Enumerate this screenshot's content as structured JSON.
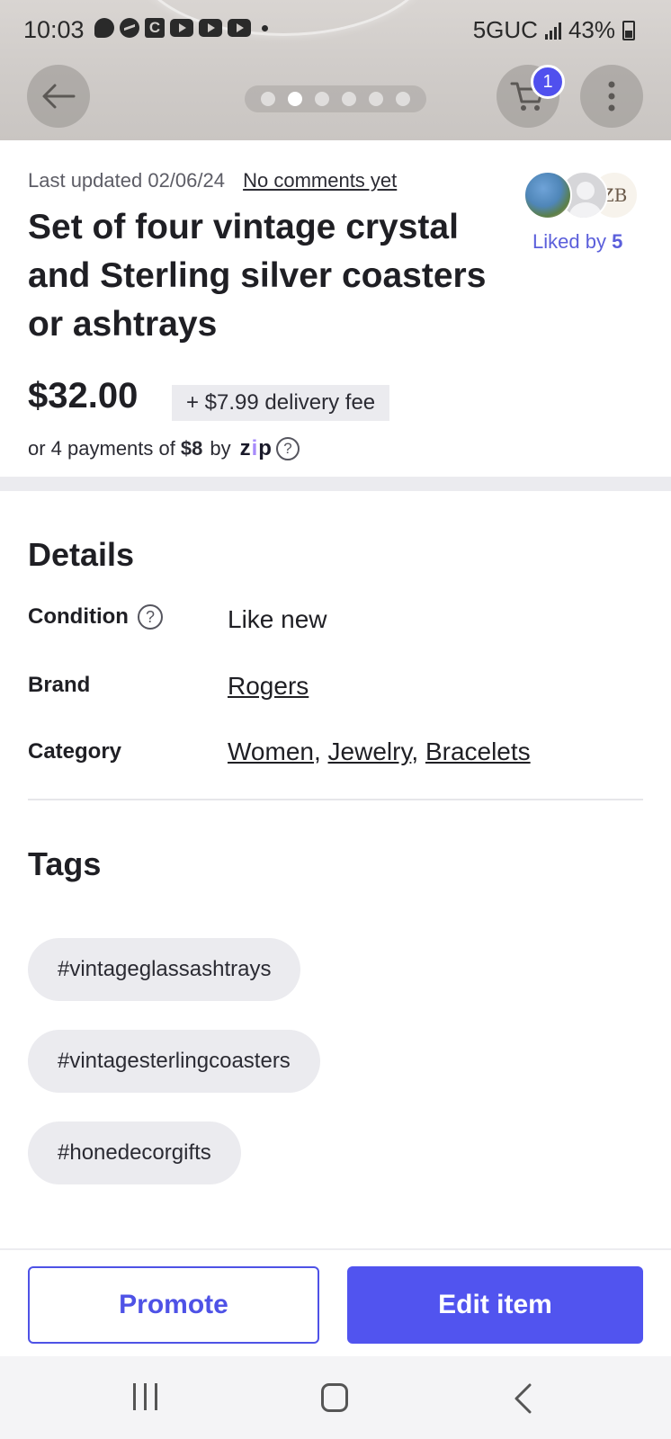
{
  "status_bar": {
    "time": "10:03",
    "network": "5GUC",
    "battery": "43%",
    "notification_icons": [
      "bubble-icon",
      "messenger-icon",
      "c-app-icon",
      "youtube-icon",
      "youtube-icon",
      "youtube-icon",
      "dot-icon"
    ]
  },
  "top_nav": {
    "cart_count": "1",
    "pager": {
      "total": 6,
      "active_index": 1
    }
  },
  "item": {
    "last_updated": "Last updated 02/06/24",
    "comments_link": "No comments yet",
    "title": "Set of four vintage crystal and Sterling silver coasters or ashtrays",
    "price": "$32.00",
    "delivery_fee": "+ $7.99 delivery fee",
    "payments_prefix": "or 4 payments of",
    "payments_amount": "$8",
    "payments_by": "by",
    "zip_logo": "zip",
    "liked_prefix": "Liked by",
    "liked_count": "5",
    "avatar3_text": "ZB"
  },
  "details": {
    "heading": "Details",
    "condition_label": "Condition",
    "condition_value": "Like new",
    "brand_label": "Brand",
    "brand_value": "Rogers",
    "category_label": "Category",
    "category_values": [
      "Women",
      "Jewelry",
      "Bracelets"
    ],
    "category_sep": ","
  },
  "tags": {
    "heading": "Tags",
    "items": [
      "#vintageglassashtrays",
      "#vintagesterlingcoasters",
      "#honedecorgifts"
    ]
  },
  "actions": {
    "promote_label": "Promote",
    "edit_label": "Edit item"
  },
  "colors": {
    "accent": "#5154ef",
    "liked_text": "#5b5fdb",
    "chip_bg": "#ebebef"
  }
}
